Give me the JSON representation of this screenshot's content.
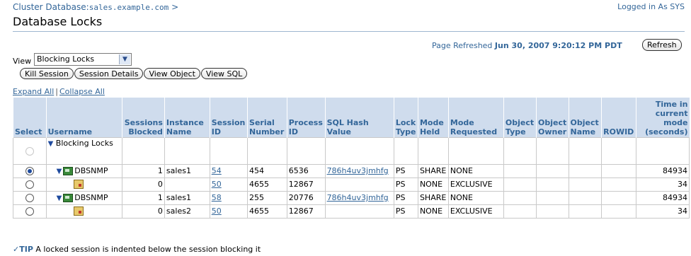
{
  "header": {
    "breadcrumb_prefix": "Cluster Database:",
    "breadcrumb_host": "sales.example.com",
    "breadcrumb_suffix": " >",
    "login_text": "Logged in As SYS",
    "page_title": "Database Locks"
  },
  "refresh": {
    "label": "Page Refreshed",
    "timestamp": "Jun 30, 2007 9:20:12 PM PDT",
    "button": "Refresh"
  },
  "view": {
    "label": "View",
    "selected": "Blocking Locks"
  },
  "actions": [
    "Kill Session",
    "Session Details",
    "View Object",
    "View SQL"
  ],
  "expand": {
    "expand_all": "Expand All",
    "collapse_all": "Collapse All"
  },
  "table": {
    "headers": {
      "select": "Select",
      "username": "Username",
      "sessions_blocked": "Sessions Blocked",
      "instance_name": "Instance Name",
      "session_id": "Session ID",
      "serial_number": "Serial Number",
      "process_id": "Process ID",
      "sql_hash": "SQL Hash Value",
      "lock_type": "Lock Type",
      "mode_held": "Mode Held",
      "mode_requested": "Mode Requested",
      "object_type": "Object Type",
      "object_owner": "Object Owner",
      "object_name": "Object Name",
      "rowid": "ROWID",
      "time_in_mode": "Time in current mode (seconds)"
    },
    "root_label": "Blocking Locks",
    "rows": [
      {
        "username": "DBSNMP",
        "blocked": "1",
        "instance": "sales1",
        "sid": "54",
        "serial": "454",
        "process": "6536",
        "sql_hash": "786h4uv3jmhfg",
        "lock_type": "PS",
        "held": "SHARE",
        "requested": "NONE",
        "time": "84934"
      },
      {
        "username": "",
        "blocked": "0",
        "instance": "",
        "sid": "50",
        "serial": "4655",
        "process": "12867",
        "sql_hash": "",
        "lock_type": "PS",
        "held": "NONE",
        "requested": "EXCLUSIVE",
        "time": "34"
      },
      {
        "username": "DBSNMP",
        "blocked": "1",
        "instance": "sales1",
        "sid": "58",
        "serial": "255",
        "process": "20776",
        "sql_hash": "786h4uv3jmhfg",
        "lock_type": "PS",
        "held": "SHARE",
        "requested": "NONE",
        "time": "84934"
      },
      {
        "username": "",
        "blocked": "0",
        "instance": "sales2",
        "sid": "50",
        "serial": "4655",
        "process": "12867",
        "sql_hash": "",
        "lock_type": "PS",
        "held": "NONE",
        "requested": "EXCLUSIVE",
        "time": "34"
      }
    ]
  },
  "tip": {
    "label": "TIP",
    "text": "A locked session is indented below the session blocking it"
  }
}
